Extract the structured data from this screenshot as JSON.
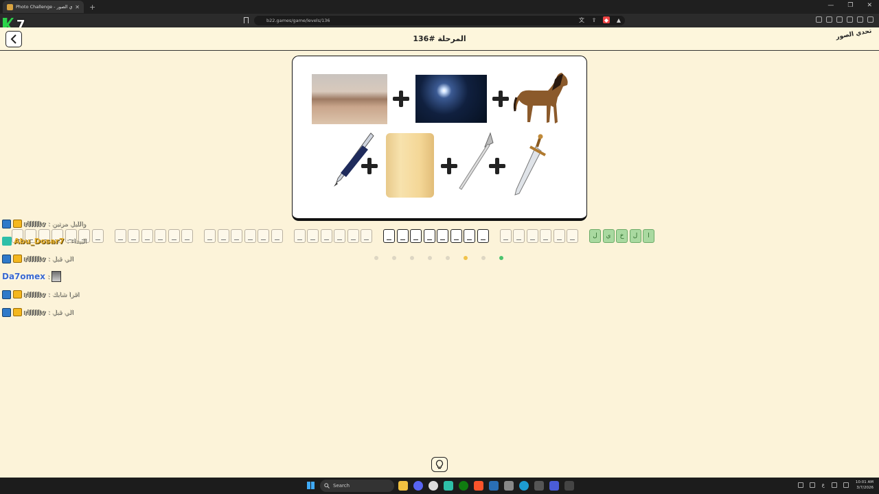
{
  "browser": {
    "tab_title": "Photo Challenge - لعبة تحدي الصور",
    "tab_close": "✕",
    "new_tab": "+",
    "url": "b22.games/game/levels/136",
    "window_controls": [
      "—",
      "❐",
      "✕"
    ]
  },
  "overlay_logo": {
    "number": "7"
  },
  "header": {
    "level_title": "المرحلة #136",
    "logo_text": "تحدي الصور"
  },
  "puzzle": {
    "row1": [
      "desert",
      "night-sky-moon",
      "horse"
    ],
    "row2": [
      "pen",
      "paper-scroll",
      "spear",
      "sword"
    ]
  },
  "answer": {
    "filled_letters": [
      "ا",
      "ل",
      "خ",
      "ي",
      "ل"
    ],
    "word_lengths": [
      5,
      6,
      8,
      6,
      6,
      6,
      7
    ],
    "active_word_index": 2,
    "colors": {
      "filled": "#a9d9a0",
      "active_border": "#222222",
      "empty_border": "#b8b0a0"
    }
  },
  "progress_dots": {
    "count": 8,
    "colors": [
      "#ddd6c3",
      "#ddd6c3",
      "#ddd6c3",
      "#ddd6c3",
      "#ddd6c3",
      "#f0c24a",
      "#ddd6c3",
      "#4cc36e"
    ]
  },
  "chat": [
    {
      "user": "rlllllv",
      "message": ": والليل مرتين",
      "badges": [
        "mod",
        "crown"
      ],
      "style": "plain"
    },
    {
      "user": "Abu_Dosar7",
      "message": ": البيداء",
      "badges": [
        "hero"
      ],
      "style": "gold"
    },
    {
      "user": "rlllllv",
      "message": ": الي قبل",
      "badges": [
        "mod",
        "crown"
      ],
      "style": "plain"
    },
    {
      "user": "Da7omex",
      "message": ":",
      "badges": [],
      "style": "blue",
      "image": true
    },
    {
      "user": "rlllllv",
      "message": ": اقرا شابك",
      "badges": [
        "mod",
        "crown"
      ],
      "style": "plain"
    },
    {
      "user": "rlllllv",
      "message": ": الي قبل",
      "badges": [
        "mod",
        "crown"
      ],
      "style": "plain"
    }
  ],
  "taskbar": {
    "search_placeholder": "Search",
    "clock_time": "10:01 AM",
    "clock_date": "3/7/2026",
    "lang": "ع"
  }
}
